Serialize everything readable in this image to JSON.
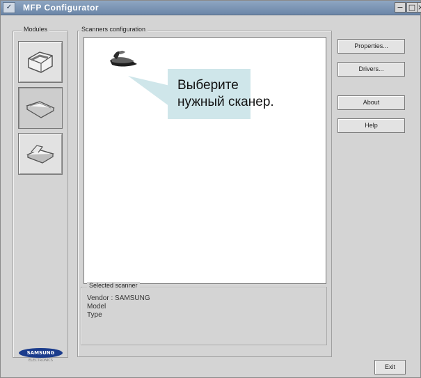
{
  "window": {
    "title": "MFP Configurator"
  },
  "modules": {
    "label": "Modules"
  },
  "scanners": {
    "label": "Scanners configuration"
  },
  "callout": {
    "line1": "Выберите",
    "line2": "нужный сканер."
  },
  "buttons": {
    "properties": "Properties...",
    "drivers": "Drivers...",
    "about": "About",
    "help": "Help",
    "exit": "Exit"
  },
  "selected_scanner": {
    "label": "Selected scanner",
    "vendor": "Vendor : SAMSUNG",
    "model": "Model",
    "type": "Type"
  },
  "logo": {
    "brand": "SAMSUNG",
    "sub": "ELECTRONICS"
  },
  "icons": [
    "window-menu-icon",
    "minimize-icon",
    "maximize-icon",
    "close-icon",
    "printer-icon",
    "scanner-icon",
    "scanner-alt-icon",
    "scanner-device-icon"
  ]
}
